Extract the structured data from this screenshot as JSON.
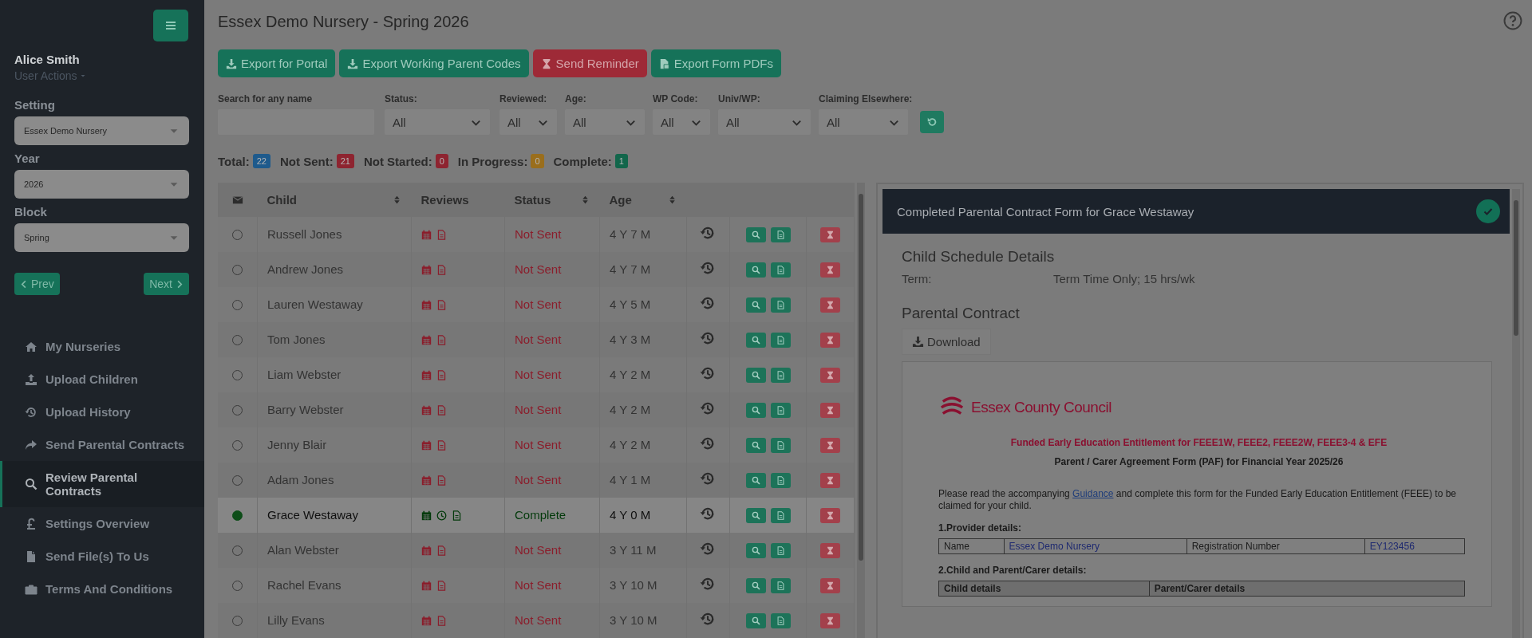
{
  "sidebar": {
    "user": {
      "name": "Alice Smith",
      "actions": "User Actions"
    },
    "pickers": [
      {
        "label": "Setting",
        "value": "Essex Demo Nursery"
      },
      {
        "label": "Year",
        "value": "2026"
      },
      {
        "label": "Block",
        "value": "Spring"
      }
    ],
    "prev": "Prev",
    "next": "Next",
    "nav": [
      {
        "label": "My Nurseries",
        "kind": "home",
        "selected": false
      },
      {
        "label": "Upload Children",
        "kind": "upload",
        "selected": false
      },
      {
        "label": "Upload History",
        "kind": "history",
        "selected": false
      },
      {
        "label": "Send Parental Contracts",
        "kind": "share",
        "selected": false
      },
      {
        "label": "Review Parental Contracts",
        "kind": "search",
        "selected": true
      },
      {
        "label": "Settings Overview",
        "kind": "pound",
        "selected": false
      },
      {
        "label": "Send File(s) To Us",
        "kind": "file",
        "selected": false
      },
      {
        "label": "Terms And Conditions",
        "kind": "briefcase",
        "selected": false
      }
    ]
  },
  "header": {
    "title": "Essex Demo Nursery - Spring 2026"
  },
  "toolbar": [
    {
      "label": "Export for Portal",
      "kind": "export"
    },
    {
      "label": "Export Working Parent Codes",
      "kind": "export"
    },
    {
      "label": "Send Reminder",
      "kind": "reminder"
    },
    {
      "label": "Export Form PDFs",
      "kind": "pdf"
    }
  ],
  "filters": [
    {
      "label": "Search for any name",
      "kind": "text"
    },
    {
      "label": "Status:",
      "kind": "select",
      "value": "All"
    },
    {
      "label": "Reviewed:",
      "kind": "select",
      "value": "All"
    },
    {
      "label": "Age:",
      "kind": "select",
      "value": "All"
    },
    {
      "label": "WP Code:",
      "kind": "select",
      "value": "All"
    },
    {
      "label": "Univ/WP:",
      "kind": "select",
      "value": "All"
    },
    {
      "label": "Claiming Elsewhere:",
      "kind": "select",
      "value": "All"
    }
  ],
  "counts": [
    {
      "label": "Total:",
      "value": "22",
      "color": "#1e5a8c"
    },
    {
      "label": "Not Sent:",
      "value": "21",
      "color": "#8e2430"
    },
    {
      "label": "Not Started:",
      "value": "0",
      "color": "#8e2430"
    },
    {
      "label": "In Progress:",
      "value": "0",
      "color": "#9a6e1c"
    },
    {
      "label": "Complete:",
      "value": "1",
      "color": "#12664b"
    }
  ],
  "table": {
    "columns": [
      {
        "label": "Child",
        "sortable": true
      },
      {
        "label": "Reviews",
        "sortable": false
      },
      {
        "label": "Status",
        "sortable": true
      },
      {
        "label": "Age",
        "sortable": true
      }
    ],
    "rows": [
      {
        "child": "Russell Jones",
        "reviews": [
          {
            "kind": "calendar"
          },
          {
            "kind": "file"
          }
        ],
        "status": "Not Sent",
        "kind": "pending",
        "age": "4 Y 7 M",
        "selected": false
      },
      {
        "child": "Andrew Jones",
        "reviews": [
          {
            "kind": "calendar"
          },
          {
            "kind": "file"
          }
        ],
        "status": "Not Sent",
        "kind": "pending",
        "age": "4 Y 7 M",
        "selected": false
      },
      {
        "child": "Lauren Westaway",
        "reviews": [
          {
            "kind": "calendar"
          },
          {
            "kind": "file"
          }
        ],
        "status": "Not Sent",
        "kind": "pending",
        "age": "4 Y 5 M",
        "selected": false
      },
      {
        "child": "Tom Jones",
        "reviews": [
          {
            "kind": "calendar"
          },
          {
            "kind": "file"
          }
        ],
        "status": "Not Sent",
        "kind": "pending",
        "age": "4 Y 3 M",
        "selected": false
      },
      {
        "child": "Liam Webster",
        "reviews": [
          {
            "kind": "calendar"
          },
          {
            "kind": "file"
          }
        ],
        "status": "Not Sent",
        "kind": "pending",
        "age": "4 Y 2 M",
        "selected": false
      },
      {
        "child": "Barry Webster",
        "reviews": [
          {
            "kind": "calendar"
          },
          {
            "kind": "file"
          }
        ],
        "status": "Not Sent",
        "kind": "pending",
        "age": "4 Y 2 M",
        "selected": false
      },
      {
        "child": "Jenny Blair",
        "reviews": [
          {
            "kind": "calendar"
          },
          {
            "kind": "file"
          }
        ],
        "status": "Not Sent",
        "kind": "pending",
        "age": "4 Y 2 M",
        "selected": false
      },
      {
        "child": "Adam Jones",
        "reviews": [
          {
            "kind": "calendar"
          },
          {
            "kind": "file"
          }
        ],
        "status": "Not Sent",
        "kind": "pending",
        "age": "4 Y 1 M",
        "selected": false
      },
      {
        "child": "Grace Westaway",
        "reviews": [
          {
            "kind": "calendar"
          },
          {
            "kind": "clock"
          },
          {
            "kind": "file"
          }
        ],
        "status": "Complete",
        "kind": "complete",
        "age": "4 Y 0 M",
        "selected": true
      },
      {
        "child": "Alan Webster",
        "reviews": [
          {
            "kind": "calendar"
          },
          {
            "kind": "file"
          }
        ],
        "status": "Not Sent",
        "kind": "pending",
        "age": "3 Y 11 M",
        "selected": false
      },
      {
        "child": "Rachel Evans",
        "reviews": [
          {
            "kind": "calendar"
          },
          {
            "kind": "file"
          }
        ],
        "status": "Not Sent",
        "kind": "pending",
        "age": "3 Y 10 M",
        "selected": false
      },
      {
        "child": "Lilly Evans",
        "reviews": [
          {
            "kind": "calendar"
          },
          {
            "kind": "file"
          }
        ],
        "status": "Not Sent",
        "kind": "pending",
        "age": "3 Y 10 M",
        "selected": false
      }
    ]
  },
  "detail": {
    "title": "Completed Parental Contract Form for Grace Westaway",
    "complete": true,
    "schedule_heading": "Child Schedule Details",
    "term_label": "Term:",
    "term_value": "Term Time Only; 15 hrs/wk",
    "contract_heading": "Parental Contract",
    "download": "Download",
    "document": {
      "org": "Essex County Council",
      "heading": "Funded Early Education Entitlement for FEEE1W, FEEE2, FEEE2W, FEEE3-4 & EFE",
      "subheading": "Parent / Carer Agreement Form (PAF) for Financial Year 2025/26",
      "intro": {
        "before": "Please read the accompanying ",
        "link": "Guidance",
        "after": " and complete this form for the Funded Early Education Entitlement (FEEE) to be claimed for your child."
      },
      "section_1": "1.Provider details:",
      "provider": [
        {
          "label": "Name",
          "value": "Essex Demo Nursery"
        },
        {
          "label": "Registration Number",
          "value": "EY123456"
        }
      ],
      "section_2": "2.Child and Parent/Carer details:",
      "section_2_columns": [
        "Child details",
        "Parent/Carer details"
      ]
    }
  }
}
